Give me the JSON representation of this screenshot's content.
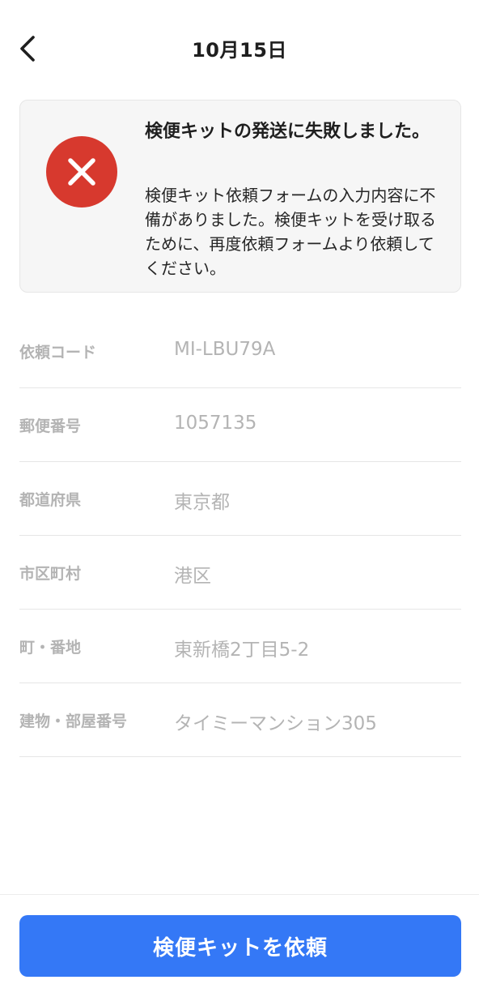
{
  "header": {
    "title": "10月15日",
    "back_icon": "chevron-left-icon"
  },
  "error": {
    "icon": "close-icon",
    "color": "#d7392e",
    "title": "検便キットの発送に失敗しました。",
    "message": "検便キット依頼フォームの入力内容に不備がありました。検便キットを受け取るために、再度依頼フォームより依頼してください。"
  },
  "fields": [
    {
      "label": "依頼コード",
      "value": "MI-LBU79A"
    },
    {
      "label": "郵便番号",
      "value": "1057135"
    },
    {
      "label": "都道府県",
      "value": "東京都"
    },
    {
      "label": "市区町村",
      "value": "港区"
    },
    {
      "label": "町・番地",
      "value": "東新橋2丁目5-2"
    },
    {
      "label": "建物・部屋番号",
      "value": "タイミーマンション305"
    }
  ],
  "footer": {
    "button_label": "検便キットを依頼",
    "accent": "#3478f6"
  }
}
